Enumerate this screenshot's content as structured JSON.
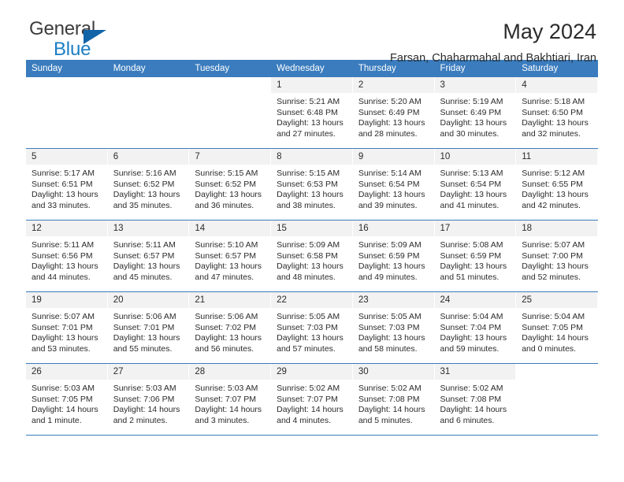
{
  "brand": {
    "name_part1": "General",
    "name_part2": "Blue",
    "flag_icon": "triangle-flag-icon"
  },
  "header": {
    "title": "May 2024",
    "subtitle": "Farsan, Chaharmahal and Bakhtiari, Iran"
  },
  "colors": {
    "header_blue": "#3a7cbe",
    "brand_blue": "#1a7dc4",
    "daynum_bg": "#f2f2f2",
    "text": "#2b2b2b"
  },
  "weekdays": [
    "Sunday",
    "Monday",
    "Tuesday",
    "Wednesday",
    "Thursday",
    "Friday",
    "Saturday"
  ],
  "weeks": [
    [
      {
        "day": "",
        "sunrise": "",
        "sunset": "",
        "daylight": "",
        "empty": true
      },
      {
        "day": "",
        "sunrise": "",
        "sunset": "",
        "daylight": "",
        "empty": true
      },
      {
        "day": "",
        "sunrise": "",
        "sunset": "",
        "daylight": "",
        "empty": true
      },
      {
        "day": "1",
        "sunrise": "Sunrise: 5:21 AM",
        "sunset": "Sunset: 6:48 PM",
        "daylight": "Daylight: 13 hours and 27 minutes."
      },
      {
        "day": "2",
        "sunrise": "Sunrise: 5:20 AM",
        "sunset": "Sunset: 6:49 PM",
        "daylight": "Daylight: 13 hours and 28 minutes."
      },
      {
        "day": "3",
        "sunrise": "Sunrise: 5:19 AM",
        "sunset": "Sunset: 6:49 PM",
        "daylight": "Daylight: 13 hours and 30 minutes."
      },
      {
        "day": "4",
        "sunrise": "Sunrise: 5:18 AM",
        "sunset": "Sunset: 6:50 PM",
        "daylight": "Daylight: 13 hours and 32 minutes."
      }
    ],
    [
      {
        "day": "5",
        "sunrise": "Sunrise: 5:17 AM",
        "sunset": "Sunset: 6:51 PM",
        "daylight": "Daylight: 13 hours and 33 minutes."
      },
      {
        "day": "6",
        "sunrise": "Sunrise: 5:16 AM",
        "sunset": "Sunset: 6:52 PM",
        "daylight": "Daylight: 13 hours and 35 minutes."
      },
      {
        "day": "7",
        "sunrise": "Sunrise: 5:15 AM",
        "sunset": "Sunset: 6:52 PM",
        "daylight": "Daylight: 13 hours and 36 minutes."
      },
      {
        "day": "8",
        "sunrise": "Sunrise: 5:15 AM",
        "sunset": "Sunset: 6:53 PM",
        "daylight": "Daylight: 13 hours and 38 minutes."
      },
      {
        "day": "9",
        "sunrise": "Sunrise: 5:14 AM",
        "sunset": "Sunset: 6:54 PM",
        "daylight": "Daylight: 13 hours and 39 minutes."
      },
      {
        "day": "10",
        "sunrise": "Sunrise: 5:13 AM",
        "sunset": "Sunset: 6:54 PM",
        "daylight": "Daylight: 13 hours and 41 minutes."
      },
      {
        "day": "11",
        "sunrise": "Sunrise: 5:12 AM",
        "sunset": "Sunset: 6:55 PM",
        "daylight": "Daylight: 13 hours and 42 minutes."
      }
    ],
    [
      {
        "day": "12",
        "sunrise": "Sunrise: 5:11 AM",
        "sunset": "Sunset: 6:56 PM",
        "daylight": "Daylight: 13 hours and 44 minutes."
      },
      {
        "day": "13",
        "sunrise": "Sunrise: 5:11 AM",
        "sunset": "Sunset: 6:57 PM",
        "daylight": "Daylight: 13 hours and 45 minutes."
      },
      {
        "day": "14",
        "sunrise": "Sunrise: 5:10 AM",
        "sunset": "Sunset: 6:57 PM",
        "daylight": "Daylight: 13 hours and 47 minutes."
      },
      {
        "day": "15",
        "sunrise": "Sunrise: 5:09 AM",
        "sunset": "Sunset: 6:58 PM",
        "daylight": "Daylight: 13 hours and 48 minutes."
      },
      {
        "day": "16",
        "sunrise": "Sunrise: 5:09 AM",
        "sunset": "Sunset: 6:59 PM",
        "daylight": "Daylight: 13 hours and 49 minutes."
      },
      {
        "day": "17",
        "sunrise": "Sunrise: 5:08 AM",
        "sunset": "Sunset: 6:59 PM",
        "daylight": "Daylight: 13 hours and 51 minutes."
      },
      {
        "day": "18",
        "sunrise": "Sunrise: 5:07 AM",
        "sunset": "Sunset: 7:00 PM",
        "daylight": "Daylight: 13 hours and 52 minutes."
      }
    ],
    [
      {
        "day": "19",
        "sunrise": "Sunrise: 5:07 AM",
        "sunset": "Sunset: 7:01 PM",
        "daylight": "Daylight: 13 hours and 53 minutes."
      },
      {
        "day": "20",
        "sunrise": "Sunrise: 5:06 AM",
        "sunset": "Sunset: 7:01 PM",
        "daylight": "Daylight: 13 hours and 55 minutes."
      },
      {
        "day": "21",
        "sunrise": "Sunrise: 5:06 AM",
        "sunset": "Sunset: 7:02 PM",
        "daylight": "Daylight: 13 hours and 56 minutes."
      },
      {
        "day": "22",
        "sunrise": "Sunrise: 5:05 AM",
        "sunset": "Sunset: 7:03 PM",
        "daylight": "Daylight: 13 hours and 57 minutes."
      },
      {
        "day": "23",
        "sunrise": "Sunrise: 5:05 AM",
        "sunset": "Sunset: 7:03 PM",
        "daylight": "Daylight: 13 hours and 58 minutes."
      },
      {
        "day": "24",
        "sunrise": "Sunrise: 5:04 AM",
        "sunset": "Sunset: 7:04 PM",
        "daylight": "Daylight: 13 hours and 59 minutes."
      },
      {
        "day": "25",
        "sunrise": "Sunrise: 5:04 AM",
        "sunset": "Sunset: 7:05 PM",
        "daylight": "Daylight: 14 hours and 0 minutes."
      }
    ],
    [
      {
        "day": "26",
        "sunrise": "Sunrise: 5:03 AM",
        "sunset": "Sunset: 7:05 PM",
        "daylight": "Daylight: 14 hours and 1 minute."
      },
      {
        "day": "27",
        "sunrise": "Sunrise: 5:03 AM",
        "sunset": "Sunset: 7:06 PM",
        "daylight": "Daylight: 14 hours and 2 minutes."
      },
      {
        "day": "28",
        "sunrise": "Sunrise: 5:03 AM",
        "sunset": "Sunset: 7:07 PM",
        "daylight": "Daylight: 14 hours and 3 minutes."
      },
      {
        "day": "29",
        "sunrise": "Sunrise: 5:02 AM",
        "sunset": "Sunset: 7:07 PM",
        "daylight": "Daylight: 14 hours and 4 minutes."
      },
      {
        "day": "30",
        "sunrise": "Sunrise: 5:02 AM",
        "sunset": "Sunset: 7:08 PM",
        "daylight": "Daylight: 14 hours and 5 minutes."
      },
      {
        "day": "31",
        "sunrise": "Sunrise: 5:02 AM",
        "sunset": "Sunset: 7:08 PM",
        "daylight": "Daylight: 14 hours and 6 minutes."
      },
      {
        "day": "",
        "sunrise": "",
        "sunset": "",
        "daylight": "",
        "empty": true
      }
    ]
  ]
}
